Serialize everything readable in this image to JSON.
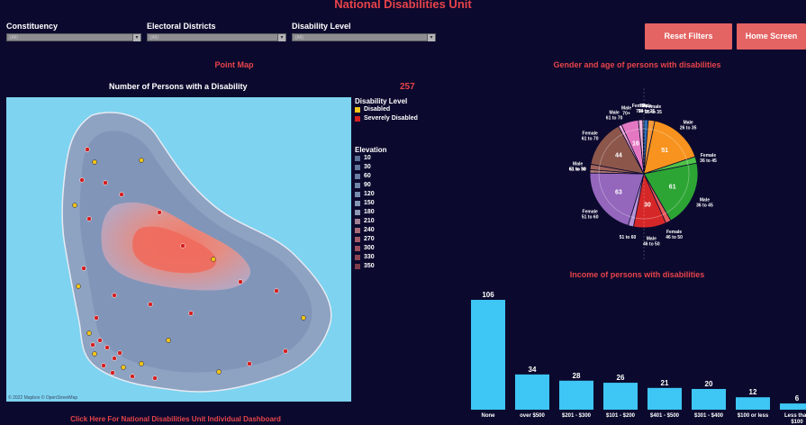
{
  "header": {
    "title": "National Disabilities Unit"
  },
  "filters": [
    {
      "label": "Constituency",
      "value": "(All)"
    },
    {
      "label": "Electoral Districts",
      "value": "(All)"
    },
    {
      "label": "Disability Level",
      "value": "(All)"
    }
  ],
  "buttons": {
    "reset": "Reset Filters",
    "home": "Home Screen"
  },
  "map": {
    "section_title": "Point Map",
    "subtitle": "Number of Persons with a Disability",
    "count": "257",
    "attribution": "© 2022 Mapbox © OpenStreetMap",
    "colors": {
      "water": "#7dd3f0",
      "disabled": "#f5c518",
      "severe": "#cc1f1f"
    }
  },
  "legend": {
    "disability_title": "Disability Level",
    "disability_items": [
      {
        "label": "Disabled",
        "color": "#f5c518"
      },
      {
        "label": "Severely Disabled",
        "color": "#d42020"
      }
    ],
    "elevation_title": "Elevation",
    "elevation_items": [
      {
        "label": "10",
        "color": "#5b6f94"
      },
      {
        "label": "30",
        "color": "#61769a"
      },
      {
        "label": "60",
        "color": "#687ea2"
      },
      {
        "label": "90",
        "color": "#6f86a8"
      },
      {
        "label": "120",
        "color": "#778daf"
      },
      {
        "label": "150",
        "color": "#8196b4"
      },
      {
        "label": "180",
        "color": "#8d97b4"
      },
      {
        "label": "210",
        "color": "#a07f92"
      },
      {
        "label": "240",
        "color": "#a76b78"
      },
      {
        "label": "270",
        "color": "#a25a66"
      },
      {
        "label": "300",
        "color": "#9a4d5a"
      },
      {
        "label": "330",
        "color": "#8e4452"
      },
      {
        "label": "350",
        "color": "#7e3b48"
      }
    ]
  },
  "pie_section": {
    "title": "Gender and age of persons with disabilities"
  },
  "bar_section": {
    "title": "Income of persons with disabilities"
  },
  "chart_data": [
    {
      "type": "pie",
      "title": "Gender and age of persons with disabilities",
      "slices": [
        {
          "label": "Male 18 to 25",
          "value": 4,
          "color": "#2f6fb5"
        },
        {
          "label": "Female 26 to 35",
          "value": 6,
          "color": "#f59a3a"
        },
        {
          "label": "Male 26 to 35",
          "value": 51,
          "color": "#f7931e"
        },
        {
          "label": "Female 36 to 45",
          "value": 6,
          "color": "#4fc247"
        },
        {
          "label": "Male 36 to 45",
          "value": 61,
          "color": "#2da534"
        },
        {
          "label": "Female 46 to 50",
          "value": 5,
          "color": "#e85a5a"
        },
        {
          "label": "Male 46 to 50",
          "value": 30,
          "color": "#d62728"
        },
        {
          "label": "51 to 60",
          "value": 5,
          "color": "#b794d8"
        },
        {
          "label": "Female 51 to 60",
          "value": 63,
          "color": "#9467bd"
        },
        {
          "label": "61 to 70",
          "value": 3,
          "color": "#b07a70"
        },
        {
          "label": "Male 51 to 60",
          "value": 5,
          "color": "#a0635a"
        },
        {
          "label": "Female 61 to 70",
          "value": 44,
          "color": "#8c564b"
        },
        {
          "label": "Male 61 to 70",
          "value": 3,
          "color": "#f2a6d8"
        },
        {
          "label": "Male 70+",
          "value": 16,
          "color": "#e377c2"
        },
        {
          "label": "Female 70+",
          "value": 4,
          "color": "#f4b6dc"
        },
        {
          "label": "70+",
          "value": 1,
          "color": "#c9c9c9"
        }
      ]
    },
    {
      "type": "bar",
      "title": "Income of persons with disabilities",
      "categories": [
        "None",
        "over $500",
        "$201 - $300",
        "$101 - $200",
        "$401 - $500",
        "$301 - $400",
        "$100 or less",
        "Less than $100"
      ],
      "values": [
        106,
        34,
        28,
        26,
        21,
        20,
        12,
        6
      ],
      "color": "#3ec6f5"
    }
  ],
  "footer": {
    "link": "Click Here For National Disabilities Unit Individual Dashboard"
  }
}
